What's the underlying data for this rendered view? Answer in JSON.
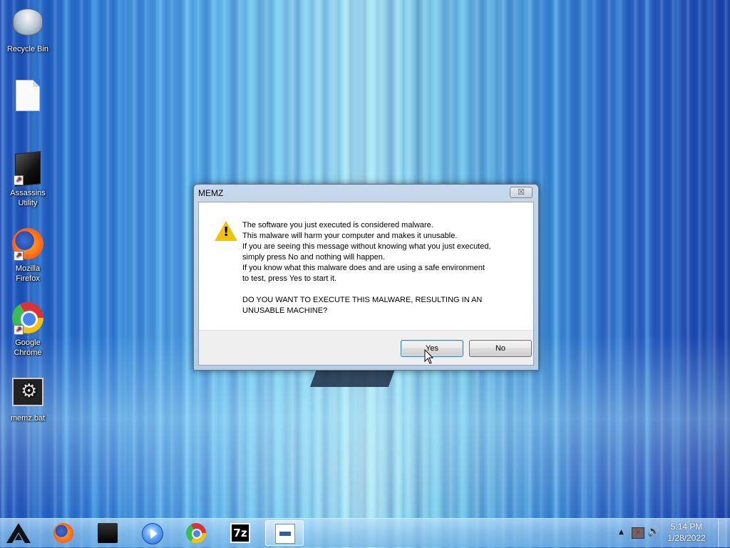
{
  "desktop": {
    "icons": [
      {
        "label": "Recycle Bin",
        "icon": "recycle-bin-icon"
      },
      {
        "label": "",
        "icon": "document-icon"
      },
      {
        "label": "Assassins\nUtility",
        "icon": "assassins-utility-icon"
      },
      {
        "label": "Mozilla\nFirefox",
        "icon": "firefox-icon"
      },
      {
        "label": "Google\nChrome",
        "icon": "chrome-icon"
      },
      {
        "label": "memz.bat",
        "icon": "batch-file-icon"
      }
    ]
  },
  "dialog": {
    "title": "MEMZ",
    "close_label": "☒",
    "icon": "warning-icon",
    "lines": [
      "The software you just executed is considered malware.",
      "This malware will harm your computer and makes it unusable.",
      "If you are seeing this message without knowing what you just executed,",
      "simply press No and nothing will happen.",
      "If you know what this malware does and are using a safe environment",
      "to test, press Yes to start it."
    ],
    "question_lines": [
      "DO YOU WANT TO EXECUTE THIS MALWARE, RESULTING IN AN",
      "UNUSABLE MACHINE?"
    ],
    "buttons": {
      "yes": "Yes",
      "no": "No"
    }
  },
  "taskbar": {
    "items": [
      {
        "name": "firefox",
        "icon": "firefox-icon"
      },
      {
        "name": "drive",
        "icon": "drive-icon"
      },
      {
        "name": "media-player",
        "icon": "media-player-icon"
      },
      {
        "name": "chrome",
        "icon": "chrome-icon"
      },
      {
        "name": "7-zip",
        "icon": "7zip-icon",
        "label": "7z"
      },
      {
        "name": "notepad",
        "icon": "notepad-icon",
        "active": true
      }
    ],
    "tray": {
      "time": "5:14 PM",
      "date": "1/28/2022"
    }
  }
}
